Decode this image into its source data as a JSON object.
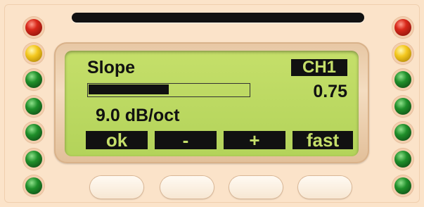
{
  "lcd": {
    "title": "Slope",
    "channel": "CH1",
    "value": "0.75",
    "readout": "9.0 dB/oct",
    "level_fraction": 0.5
  },
  "softkeys": {
    "ok": "ok",
    "minus": "-",
    "plus": "+",
    "fast": "fast"
  },
  "leds": {
    "left": [
      "red",
      "yellow",
      "green",
      "green",
      "green",
      "green",
      "green"
    ],
    "right": [
      "red",
      "yellow",
      "green",
      "green",
      "green",
      "green",
      "green"
    ]
  },
  "colors": {
    "lcd_background": "#c5df6a",
    "panel": "#fbe3c9",
    "led_red": "#d8281a",
    "led_yellow": "#f4c81e",
    "led_green": "#1f8f2a"
  }
}
